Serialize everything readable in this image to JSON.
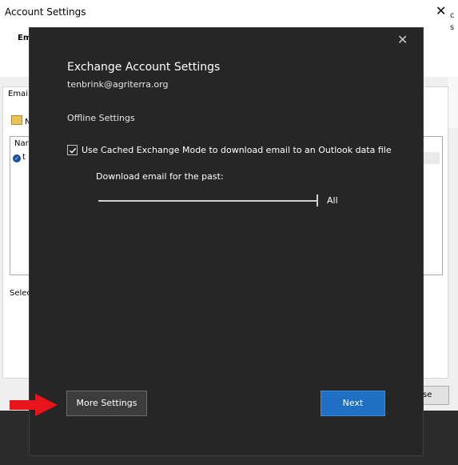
{
  "background_window": {
    "title": "Account Settings",
    "close_glyph": "✕",
    "tab_fragment": "Em",
    "right_fragment_1": "c",
    "right_fragment_2": "s",
    "email_tab_fragment": "Email",
    "new_fragment": "N",
    "list_header_fragment": "Nar",
    "list_row_fragment": "t",
    "select_fragment": "Selec",
    "close_button_fragment": "se"
  },
  "dialog": {
    "close_glyph": "✕",
    "title": "Exchange Account Settings",
    "email": "tenbrink@agriterra.org",
    "section_header": "Offline Settings",
    "cached_mode": {
      "label": "Use Cached Exchange Mode to download email to an Outlook data file",
      "checked": true
    },
    "download_label": "Download email for the past:",
    "slider_value": "All",
    "slider_level": 1.0,
    "buttons": {
      "more_settings": "More Settings",
      "next": "Next"
    }
  },
  "annotation": {
    "arrow_color": "#e8141b",
    "icon": "red-arrow-icon"
  },
  "colors": {
    "dialog_bg": "#262626",
    "accent": "#1f6fc4"
  }
}
